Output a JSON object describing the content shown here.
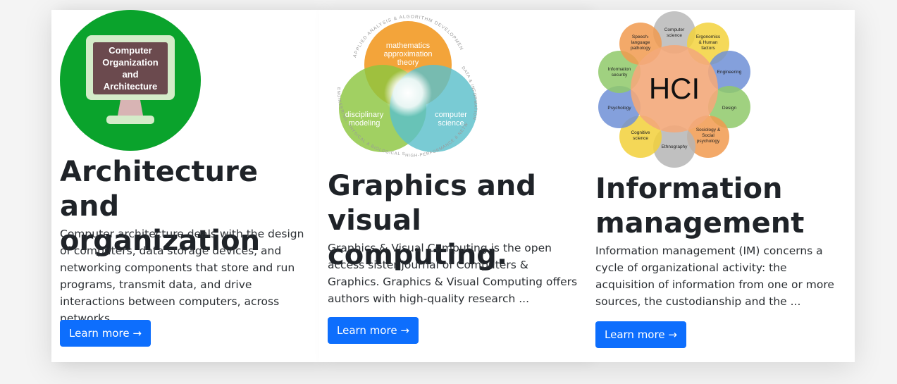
{
  "cards": [
    {
      "title": "Architecture and organization",
      "description": "Computer architecture deals with the design of computers, data storage devices, and networking components that store and run programs, transmit data, and drive interactions between computers, across networks,.",
      "button": "Learn more →",
      "image": {
        "icon": "monitor-icon",
        "lines": [
          "Computer",
          "Organization",
          "and",
          "Architecture"
        ],
        "colors": {
          "circle": "#0aa32c",
          "screen": "#6b4a4e",
          "bezel": "#d4ecc9"
        }
      }
    },
    {
      "title": "Graphics and visual computing.",
      "description": "Graphics & Visual Computing is the open access sister journal of Computers & Graphics. Graphics & Visual Computing offers authors with high-quality research ...",
      "button": "Learn more →",
      "image": {
        "icon": "venn-diagram-icon",
        "top": [
          "mathematics",
          "approximation",
          "theory"
        ],
        "left": [
          "disciplinary",
          "modeling"
        ],
        "right": [
          "computer",
          "science"
        ],
        "arc_top": "APPLIED ANALYSIS & ALGORITHM DEVELOPMENT",
        "arc_left": "ENGINEERING, PHYSICAL & BIOLOGICAL SCIENCES",
        "arc_right": "DATA & INFORMATION SCIENCES",
        "arc_bottom": "HIGH-PERFORMANCE & NETWORKED COMPUTING",
        "colors": {
          "top": "#f29a25",
          "left": "#8cc63f",
          "right": "#5bbfcb"
        }
      }
    },
    {
      "title": "Information management",
      "description": "Information management (IM) concerns a cycle of organizational activity: the acquisition of information from one or more sources, the custodianship and the ...",
      "button": "Learn more →",
      "image": {
        "icon": "hci-diagram-icon",
        "center": "HCI",
        "petals": [
          {
            "label": [
              "Computer",
              "science"
            ],
            "color": "#b9b9b9"
          },
          {
            "label": [
              "Ergonomics",
              "& Human",
              "factors"
            ],
            "color": "#f3d23c"
          },
          {
            "label": [
              "Engineering"
            ],
            "color": "#6f8fd6"
          },
          {
            "label": [
              "Design"
            ],
            "color": "#8fc96a"
          },
          {
            "label": [
              "Sociology &",
              "Social",
              "psychology"
            ],
            "color": "#f19a4f"
          },
          {
            "label": [
              "Ethnography"
            ],
            "color": "#b5b5b5"
          },
          {
            "label": [
              "Cognitive",
              "science"
            ],
            "color": "#f2d03a"
          },
          {
            "label": [
              "Psychology"
            ],
            "color": "#6f8fd6"
          },
          {
            "label": [
              "Information",
              "security"
            ],
            "color": "#8fc96a"
          },
          {
            "label": [
              "Speech-",
              "language",
              "pathology"
            ],
            "color": "#f19a4f"
          }
        ],
        "colors": {
          "center": "#f3a97a"
        }
      }
    }
  ]
}
